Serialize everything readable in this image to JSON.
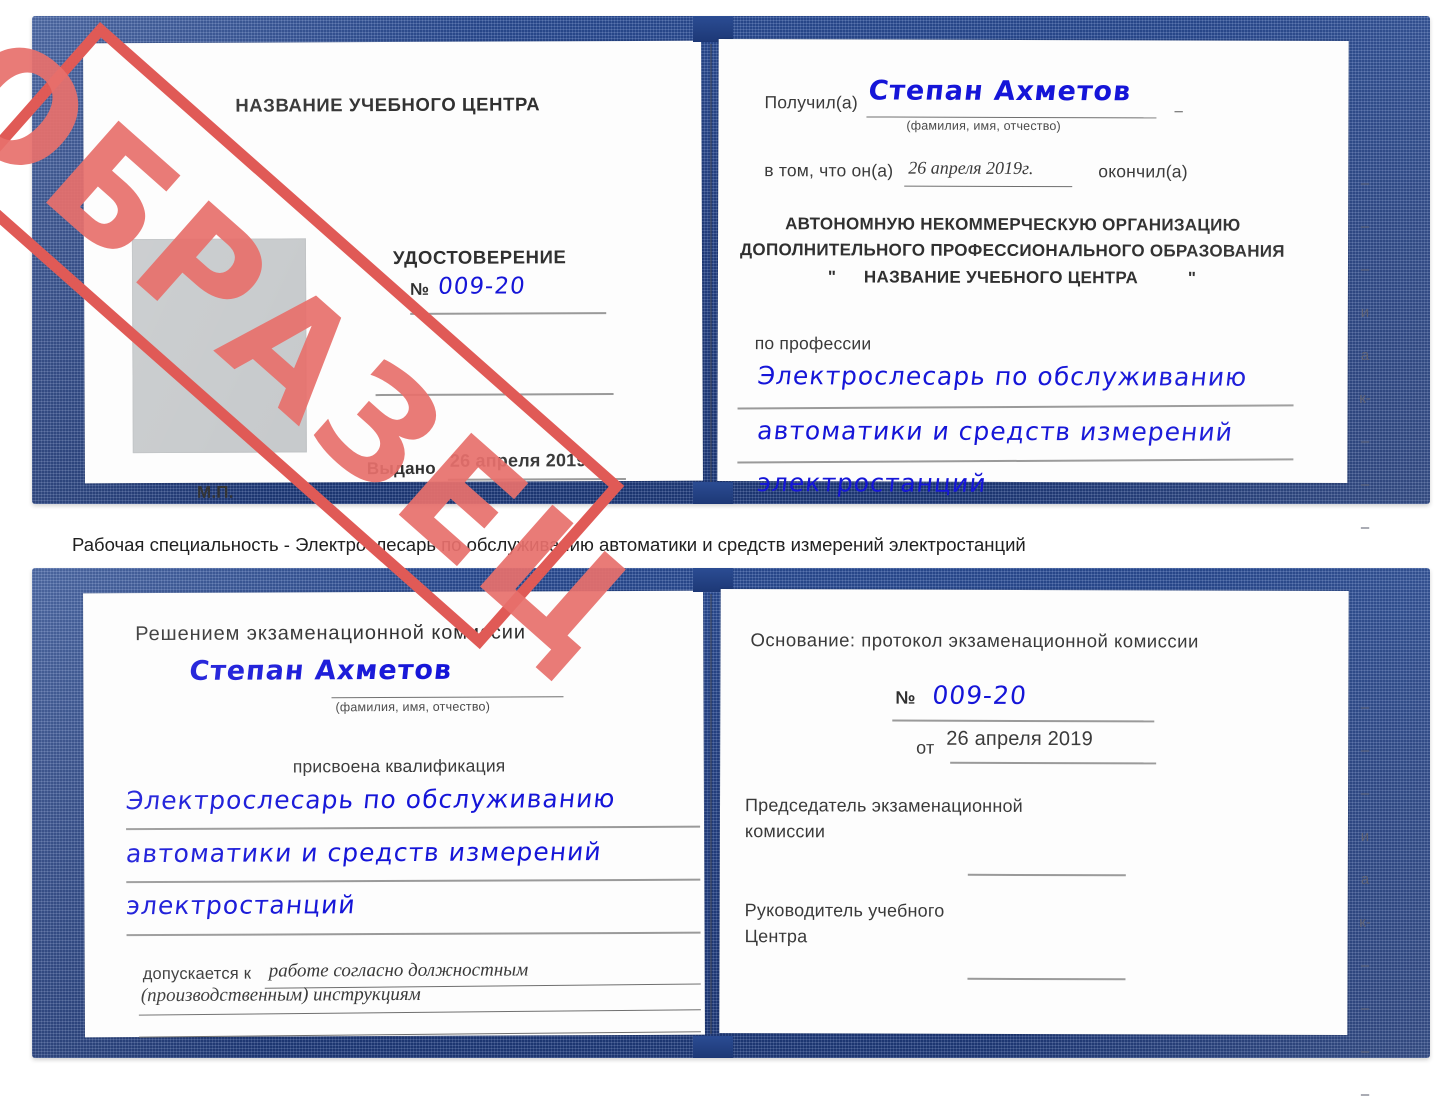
{
  "caption": {
    "text": "Рабочая специальность - Электрослесарь по обслуживанию автоматики и средств измерений электростанций"
  },
  "stamp": {
    "label": "ОБРАЗЕЦ",
    "color": "#e05a56",
    "text_color": "#e8706c"
  },
  "certificate_top": {
    "left_page": {
      "header": "НАЗВАНИЕ УЧЕБНОГО ЦЕНТРА",
      "doc_type": "УДОСТОВЕРЕНИЕ",
      "number_label": "№",
      "number_value": "009-20",
      "issued_label": "Выдано",
      "issued_value": "26 апреля 2019",
      "seal_label": "М.П."
    },
    "right_page": {
      "received_label": "Получил(а)",
      "received_value": "Степан Ахметов",
      "received_hint": "(фамилия, имя, отчество)",
      "in_that_label": "в том, что он(а)",
      "completion_date": "26 апреля 2019г.",
      "finished_label": "окончил(а)",
      "org_line1": "АВТОНОМНУЮ НЕКОММЕРЧЕСКУЮ ОРГАНИЗАЦИЮ",
      "org_line2": "ДОПОЛНИТЕЛЬНОГО ПРОФЕССИОНАЛЬНОГО ОБРАЗОВАНИЯ",
      "org_quote_open": "\"",
      "org_line3": "НАЗВАНИЕ УЧЕБНОГО ЦЕНТРА",
      "org_quote_close": "\"",
      "profession_label": "по профессии",
      "profession_line1": "Электрослесарь по обслуживанию",
      "profession_line2": "автоматики и средств измерений",
      "profession_line3": "электростанций"
    },
    "margin_chars": [
      "–",
      "–",
      "–",
      "и",
      "а",
      "к-",
      "–",
      "–",
      "–"
    ]
  },
  "certificate_bottom": {
    "left_page": {
      "decision_header": "Решением экзаменационной комиссии",
      "name_value": "Степан Ахметов",
      "name_hint": "(фамилия, имя, отчество)",
      "qualification_label": "присвоена квалификация",
      "qualification_line1": "Электрослесарь по обслуживанию",
      "qualification_line2": "автоматики и средств измерений",
      "qualification_line3": "электростанций",
      "admitted_label": "допускается к",
      "admitted_value_line1": "работе согласно должностным",
      "admitted_value_line2": "(производственным) инструкциям"
    },
    "right_page": {
      "basis_label": "Основание: протокол экзаменационной комиссии",
      "number_label": "№",
      "number_value": "009-20",
      "date_label": "от",
      "date_value": "26 апреля 2019",
      "chairman_line1": "Председатель экзаменационной",
      "chairman_line2": "комиссии",
      "director_line1": "Руководитель учебного",
      "director_line2": "Центра"
    },
    "margin_chars": [
      "–",
      "–",
      "–",
      "и",
      "а",
      "к-",
      "–",
      "–",
      "–",
      "–"
    ]
  }
}
